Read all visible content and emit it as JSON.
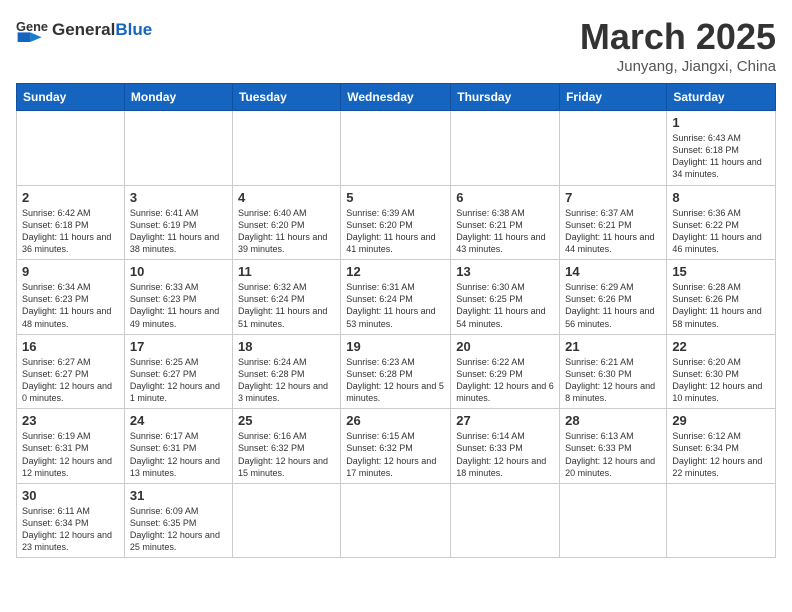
{
  "header": {
    "logo_general": "General",
    "logo_blue": "Blue",
    "month_title": "March 2025",
    "location": "Junyang, Jiangxi, China"
  },
  "weekdays": [
    "Sunday",
    "Monday",
    "Tuesday",
    "Wednesday",
    "Thursday",
    "Friday",
    "Saturday"
  ],
  "weeks": [
    [
      {
        "day": "",
        "info": ""
      },
      {
        "day": "",
        "info": ""
      },
      {
        "day": "",
        "info": ""
      },
      {
        "day": "",
        "info": ""
      },
      {
        "day": "",
        "info": ""
      },
      {
        "day": "",
        "info": ""
      },
      {
        "day": "1",
        "info": "Sunrise: 6:43 AM\nSunset: 6:18 PM\nDaylight: 11 hours and 34 minutes."
      }
    ],
    [
      {
        "day": "2",
        "info": "Sunrise: 6:42 AM\nSunset: 6:18 PM\nDaylight: 11 hours and 36 minutes."
      },
      {
        "day": "3",
        "info": "Sunrise: 6:41 AM\nSunset: 6:19 PM\nDaylight: 11 hours and 38 minutes."
      },
      {
        "day": "4",
        "info": "Sunrise: 6:40 AM\nSunset: 6:20 PM\nDaylight: 11 hours and 39 minutes."
      },
      {
        "day": "5",
        "info": "Sunrise: 6:39 AM\nSunset: 6:20 PM\nDaylight: 11 hours and 41 minutes."
      },
      {
        "day": "6",
        "info": "Sunrise: 6:38 AM\nSunset: 6:21 PM\nDaylight: 11 hours and 43 minutes."
      },
      {
        "day": "7",
        "info": "Sunrise: 6:37 AM\nSunset: 6:21 PM\nDaylight: 11 hours and 44 minutes."
      },
      {
        "day": "8",
        "info": "Sunrise: 6:36 AM\nSunset: 6:22 PM\nDaylight: 11 hours and 46 minutes."
      }
    ],
    [
      {
        "day": "9",
        "info": "Sunrise: 6:34 AM\nSunset: 6:23 PM\nDaylight: 11 hours and 48 minutes."
      },
      {
        "day": "10",
        "info": "Sunrise: 6:33 AM\nSunset: 6:23 PM\nDaylight: 11 hours and 49 minutes."
      },
      {
        "day": "11",
        "info": "Sunrise: 6:32 AM\nSunset: 6:24 PM\nDaylight: 11 hours and 51 minutes."
      },
      {
        "day": "12",
        "info": "Sunrise: 6:31 AM\nSunset: 6:24 PM\nDaylight: 11 hours and 53 minutes."
      },
      {
        "day": "13",
        "info": "Sunrise: 6:30 AM\nSunset: 6:25 PM\nDaylight: 11 hours and 54 minutes."
      },
      {
        "day": "14",
        "info": "Sunrise: 6:29 AM\nSunset: 6:26 PM\nDaylight: 11 hours and 56 minutes."
      },
      {
        "day": "15",
        "info": "Sunrise: 6:28 AM\nSunset: 6:26 PM\nDaylight: 11 hours and 58 minutes."
      }
    ],
    [
      {
        "day": "16",
        "info": "Sunrise: 6:27 AM\nSunset: 6:27 PM\nDaylight: 12 hours and 0 minutes."
      },
      {
        "day": "17",
        "info": "Sunrise: 6:25 AM\nSunset: 6:27 PM\nDaylight: 12 hours and 1 minute."
      },
      {
        "day": "18",
        "info": "Sunrise: 6:24 AM\nSunset: 6:28 PM\nDaylight: 12 hours and 3 minutes."
      },
      {
        "day": "19",
        "info": "Sunrise: 6:23 AM\nSunset: 6:28 PM\nDaylight: 12 hours and 5 minutes."
      },
      {
        "day": "20",
        "info": "Sunrise: 6:22 AM\nSunset: 6:29 PM\nDaylight: 12 hours and 6 minutes."
      },
      {
        "day": "21",
        "info": "Sunrise: 6:21 AM\nSunset: 6:30 PM\nDaylight: 12 hours and 8 minutes."
      },
      {
        "day": "22",
        "info": "Sunrise: 6:20 AM\nSunset: 6:30 PM\nDaylight: 12 hours and 10 minutes."
      }
    ],
    [
      {
        "day": "23",
        "info": "Sunrise: 6:19 AM\nSunset: 6:31 PM\nDaylight: 12 hours and 12 minutes."
      },
      {
        "day": "24",
        "info": "Sunrise: 6:17 AM\nSunset: 6:31 PM\nDaylight: 12 hours and 13 minutes."
      },
      {
        "day": "25",
        "info": "Sunrise: 6:16 AM\nSunset: 6:32 PM\nDaylight: 12 hours and 15 minutes."
      },
      {
        "day": "26",
        "info": "Sunrise: 6:15 AM\nSunset: 6:32 PM\nDaylight: 12 hours and 17 minutes."
      },
      {
        "day": "27",
        "info": "Sunrise: 6:14 AM\nSunset: 6:33 PM\nDaylight: 12 hours and 18 minutes."
      },
      {
        "day": "28",
        "info": "Sunrise: 6:13 AM\nSunset: 6:33 PM\nDaylight: 12 hours and 20 minutes."
      },
      {
        "day": "29",
        "info": "Sunrise: 6:12 AM\nSunset: 6:34 PM\nDaylight: 12 hours and 22 minutes."
      }
    ],
    [
      {
        "day": "30",
        "info": "Sunrise: 6:11 AM\nSunset: 6:34 PM\nDaylight: 12 hours and 23 minutes."
      },
      {
        "day": "31",
        "info": "Sunrise: 6:09 AM\nSunset: 6:35 PM\nDaylight: 12 hours and 25 minutes."
      },
      {
        "day": "",
        "info": ""
      },
      {
        "day": "",
        "info": ""
      },
      {
        "day": "",
        "info": ""
      },
      {
        "day": "",
        "info": ""
      },
      {
        "day": "",
        "info": ""
      }
    ]
  ]
}
